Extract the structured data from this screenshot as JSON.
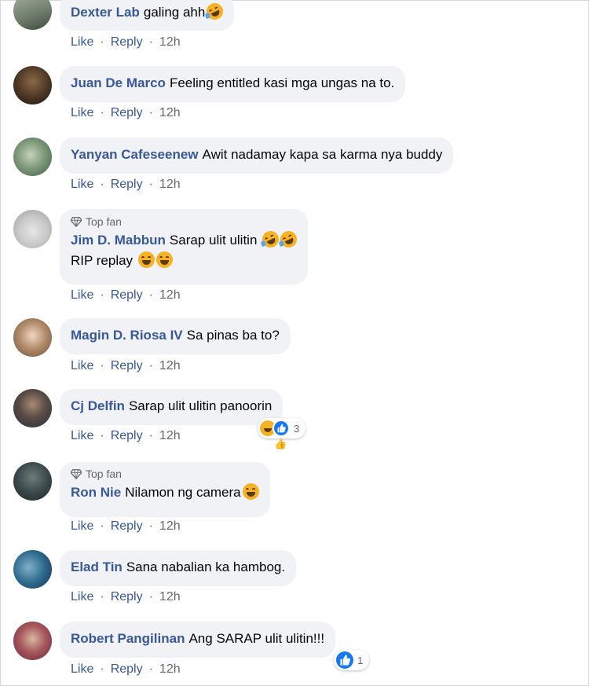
{
  "actions": {
    "like": "Like",
    "reply": "Reply",
    "dot": "·"
  },
  "comments": [
    {
      "author": "Dexter Lab",
      "text": "galing ahh",
      "time": "12h",
      "avatar_color": "#7d8c7a",
      "avatar_icon": "avatar-icon"
    },
    {
      "author": "Juan De Marco",
      "text": "Feeling entitled kasi mga ungas na to.",
      "time": "12h",
      "avatar_color": "#6b4a2e"
    },
    {
      "author": "Yanyan Cafeseenew",
      "text": "Awit nadamay kapa sa karma nya buddy",
      "time": "12h",
      "avatar_color": "#6f8e6d"
    },
    {
      "badge": "Top fan",
      "author": "Jim D. Mabbun",
      "text": "Sarap ulit ulitin",
      "text2": "RIP replay",
      "time": "12h",
      "avatar_color": "#cfcfcf"
    },
    {
      "author": "Magin D. Riosa IV",
      "text": "Sa pinas ba to?",
      "time": "12h",
      "avatar_color": "#9a7b5e"
    },
    {
      "author": "Cj Delfin",
      "text": "Sarap ulit ulitin panoorin",
      "time": "12h",
      "reaction_count": "3",
      "avatar_color": "#3b3f52"
    },
    {
      "badge": "Top fan",
      "author": "Ron Nie",
      "text": "Nilamon ng camera",
      "time": "12h",
      "avatar_color": "#3d4a4e"
    },
    {
      "author": "Elad Tin",
      "text": "Sana nabalian ka hambog.",
      "time": "12h",
      "avatar_color": "#2f5f88"
    },
    {
      "author": "Robert Pangilinan",
      "text": "Ang SARAP ulit ulitin!!!",
      "time": "12h",
      "reaction_count": "1",
      "avatar_color": "#b54a52"
    }
  ],
  "colors": {
    "author": "#385898",
    "bubble": "#f0f2f5",
    "meta": "#65676b"
  }
}
